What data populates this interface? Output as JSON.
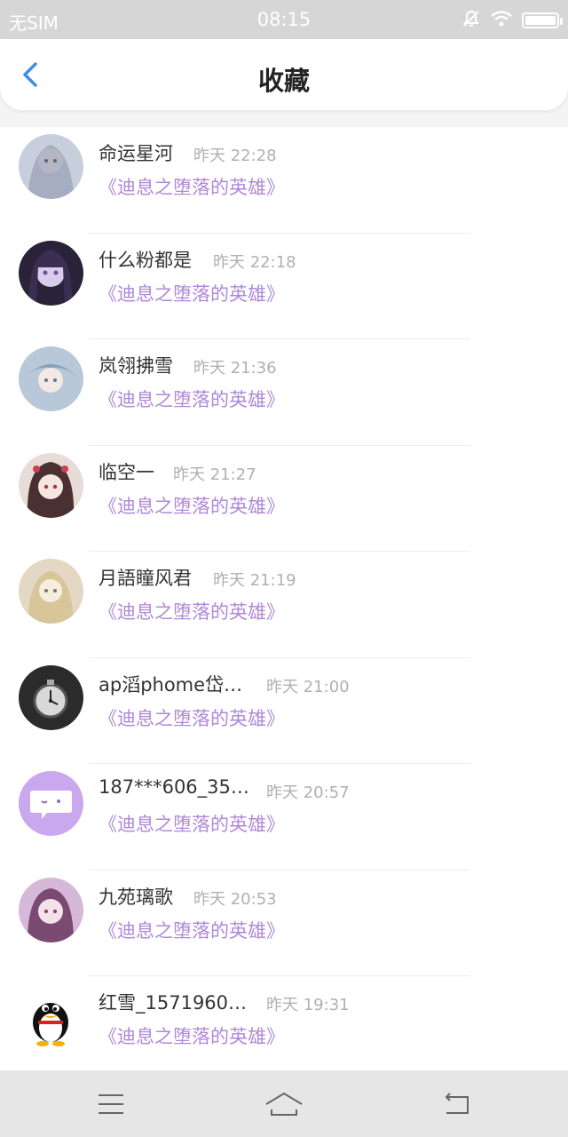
{
  "status_bar": {
    "carrier": "无SIM",
    "time": "08:15",
    "icons": [
      "mute-icon",
      "wifi-icon",
      "battery-icon"
    ]
  },
  "header": {
    "title": "收藏",
    "back_icon": "back-chevron-icon",
    "accent_color": "#3d8fe0"
  },
  "list": {
    "name_color": "#333333",
    "time_color": "#b0b0b0",
    "book_color": "#b088d8",
    "items": [
      {
        "name": "命运星河",
        "time": "昨天 22:28",
        "book": "《迪息之堕落的英雄》",
        "avatar": "anime-girl-avatar"
      },
      {
        "name": "什么粉都是",
        "time": "昨天 22:18",
        "book": "《迪息之堕落的英雄》",
        "avatar": "anime-girl-avatar"
      },
      {
        "name": "岚翎拂雪",
        "time": "昨天 21:36",
        "book": "《迪息之堕落的英雄》",
        "avatar": "anime-girl-avatar"
      },
      {
        "name": "临空一",
        "time": "昨天 21:27",
        "book": "《迪息之堕落的英雄》",
        "avatar": "anime-girl-avatar"
      },
      {
        "name": "月語瞳风君",
        "time": "昨天 21:19",
        "book": "《迪息之堕落的英雄》",
        "avatar": "anime-girl-avatar"
      },
      {
        "name": "ap滔phome岱…",
        "time": "昨天 21:00",
        "book": "《迪息之堕落的英雄》",
        "avatar": "pocket-watch-avatar"
      },
      {
        "name": "187***606_35…",
        "time": "昨天 20:57",
        "book": "《迪息之堕落的英雄》",
        "avatar": "chat-bubble-avatar"
      },
      {
        "name": "九苑璃歌",
        "time": "昨天 20:53",
        "book": "《迪息之堕落的英雄》",
        "avatar": "anime-girl-avatar"
      },
      {
        "name": "红雪_1571960…",
        "time": "昨天 19:31",
        "book": "《迪息之堕落的英雄》",
        "avatar": "penguin-avatar"
      }
    ]
  },
  "nav_bar": {
    "buttons": [
      "menu-icon",
      "home-icon",
      "back-icon"
    ]
  }
}
